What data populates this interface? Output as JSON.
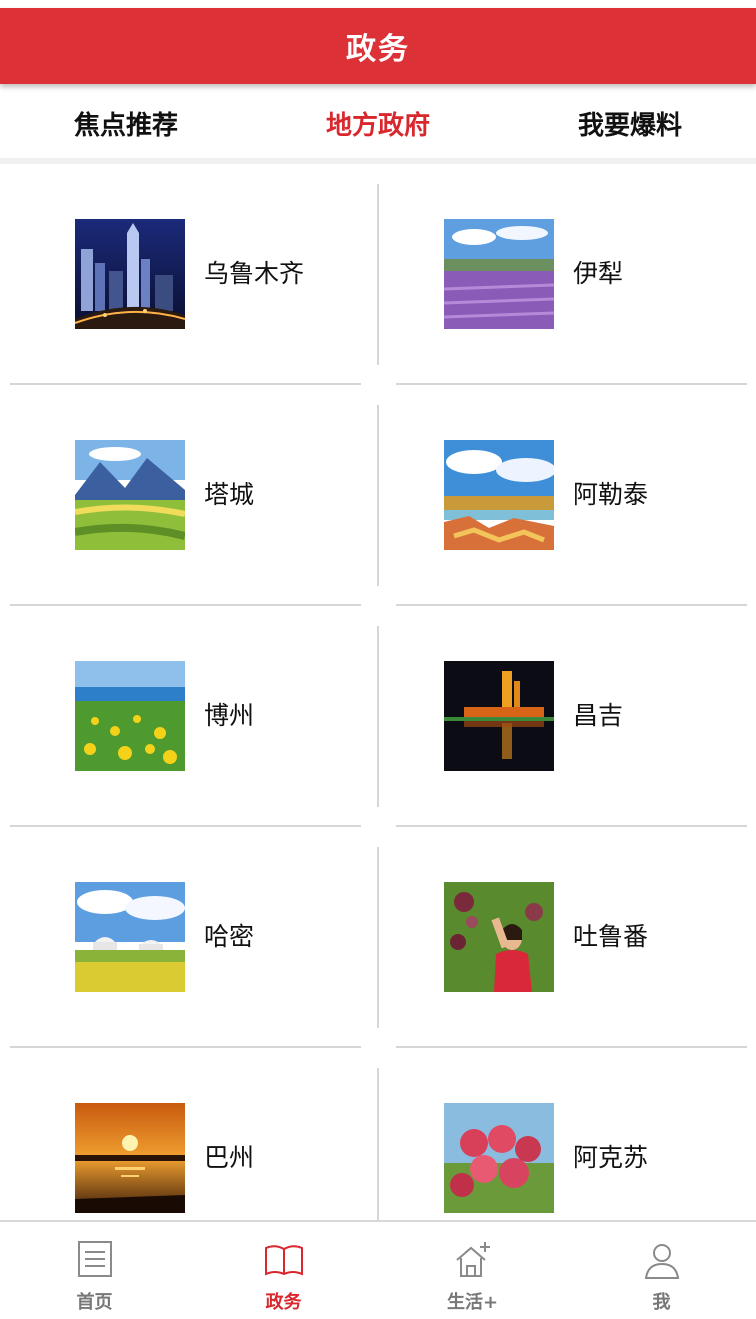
{
  "header": {
    "title": "政务"
  },
  "tabs": [
    {
      "label": "焦点推荐",
      "active": false
    },
    {
      "label": "地方政府",
      "active": true
    },
    {
      "label": "我要爆料",
      "active": false
    }
  ],
  "regions": [
    {
      "label": "乌鲁木齐",
      "image": "city-night-skyline"
    },
    {
      "label": "伊犁",
      "image": "lavender-field"
    },
    {
      "label": "塔城",
      "image": "green-hills-mountains"
    },
    {
      "label": "阿勒泰",
      "image": "colorful-lake-landscape"
    },
    {
      "label": "博州",
      "image": "yellow-flower-meadow-lake"
    },
    {
      "label": "昌吉",
      "image": "lit-building-reflection"
    },
    {
      "label": "哈密",
      "image": "yurts-flower-field"
    },
    {
      "label": "吐鲁番",
      "image": "woman-picking-grapes"
    },
    {
      "label": "巴州",
      "image": "sunset-over-water"
    },
    {
      "label": "阿克苏",
      "image": "red-apples-tree"
    }
  ],
  "bottom_nav": [
    {
      "label": "首页",
      "icon": "document-icon",
      "active": false
    },
    {
      "label": "政务",
      "icon": "open-book-icon",
      "active": true
    },
    {
      "label": "生活+",
      "icon": "house-plus-icon",
      "active": false
    },
    {
      "label": "我",
      "icon": "person-icon",
      "active": false
    }
  ],
  "colors": {
    "accent": "#dc3237",
    "divider": "#d6d6d6",
    "inactive_nav": "#777777"
  }
}
